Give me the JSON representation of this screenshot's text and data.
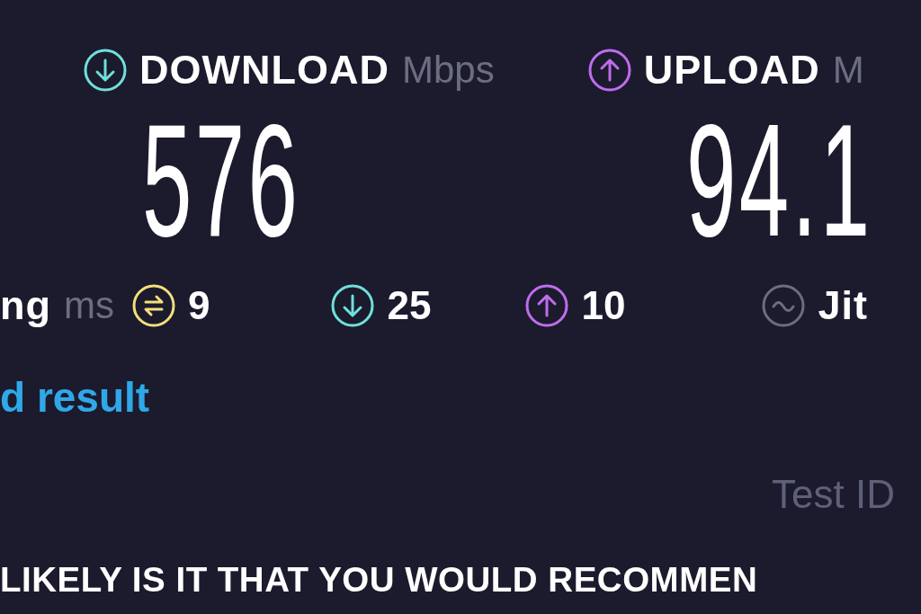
{
  "download": {
    "label": "DOWNLOAD",
    "unit": "Mbps",
    "value": "576"
  },
  "upload": {
    "label": "UPLOAD",
    "unit": "M",
    "value": "94.1"
  },
  "latency": {
    "label": "ng",
    "unit": "ms",
    "items": [
      {
        "kind": "idle",
        "value": "9"
      },
      {
        "kind": "download",
        "value": "25"
      },
      {
        "kind": "upload",
        "value": "10"
      }
    ]
  },
  "jitter": {
    "label": "Jit"
  },
  "result_link": "d result",
  "test_id_label": "Test ID",
  "survey_question": "LIKELY IS IT THAT YOU WOULD RECOMMEN"
}
